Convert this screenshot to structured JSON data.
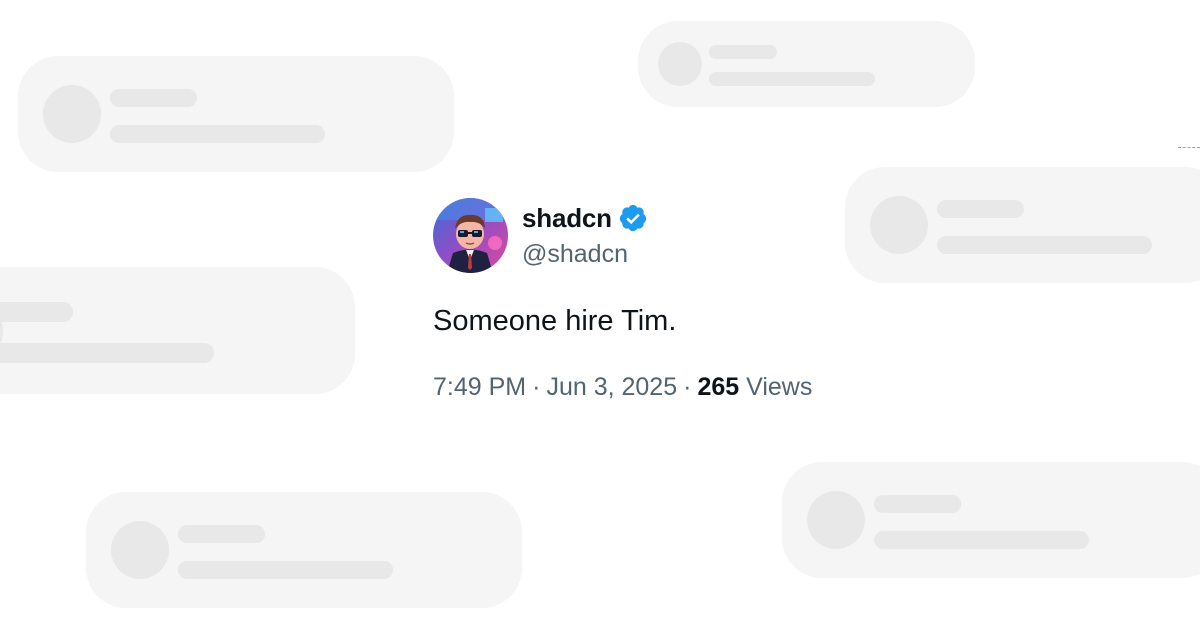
{
  "tweet": {
    "display_name": "shadcn",
    "handle": "@shadcn",
    "text": "Someone hire Tim.",
    "time": "7:49 PM",
    "date": "Jun 3, 2025",
    "separator": "·",
    "views_count": "265",
    "views_label": "Views",
    "verified": true
  },
  "icons": {
    "verified": "verified-badge-icon",
    "avatar": "user-avatar-image"
  },
  "colors": {
    "background": "#ffffff",
    "placeholder_card": "#f5f5f5",
    "placeholder_element": "#e8e8e8",
    "primary_text": "#0f1419",
    "secondary_text": "#536471",
    "verified_blue": "#1d9bf0"
  }
}
